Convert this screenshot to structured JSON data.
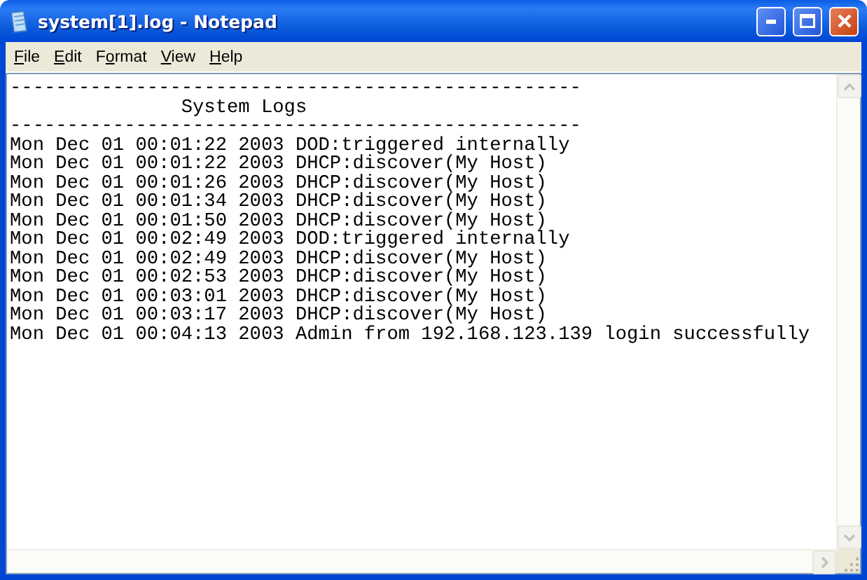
{
  "window": {
    "title": "system[1].log - Notepad"
  },
  "menu": [
    {
      "label": "File",
      "underline_second_letter": false
    },
    {
      "label": "Edit",
      "underline_second_letter": false
    },
    {
      "label": "Format",
      "underline_second_letter": true
    },
    {
      "label": "View",
      "underline_second_letter": false
    },
    {
      "label": "Help",
      "underline_second_letter": false
    }
  ],
  "document": {
    "lines": [
      "--------------------------------------------------",
      "               System Logs",
      "--------------------------------------------------",
      "Mon Dec 01 00:01:22 2003 DOD:triggered internally",
      "Mon Dec 01 00:01:22 2003 DHCP:discover(My Host)",
      "Mon Dec 01 00:01:26 2003 DHCP:discover(My Host)",
      "Mon Dec 01 00:01:34 2003 DHCP:discover(My Host)",
      "Mon Dec 01 00:01:50 2003 DHCP:discover(My Host)",
      "Mon Dec 01 00:02:49 2003 DOD:triggered internally",
      "Mon Dec 01 00:02:49 2003 DHCP:discover(My Host)",
      "Mon Dec 01 00:02:53 2003 DHCP:discover(My Host)",
      "Mon Dec 01 00:03:01 2003 DHCP:discover(My Host)",
      "Mon Dec 01 00:03:17 2003 DHCP:discover(My Host)",
      "Mon Dec 01 00:04:13 2003 Admin from 192.168.123.139 login successfully"
    ]
  }
}
